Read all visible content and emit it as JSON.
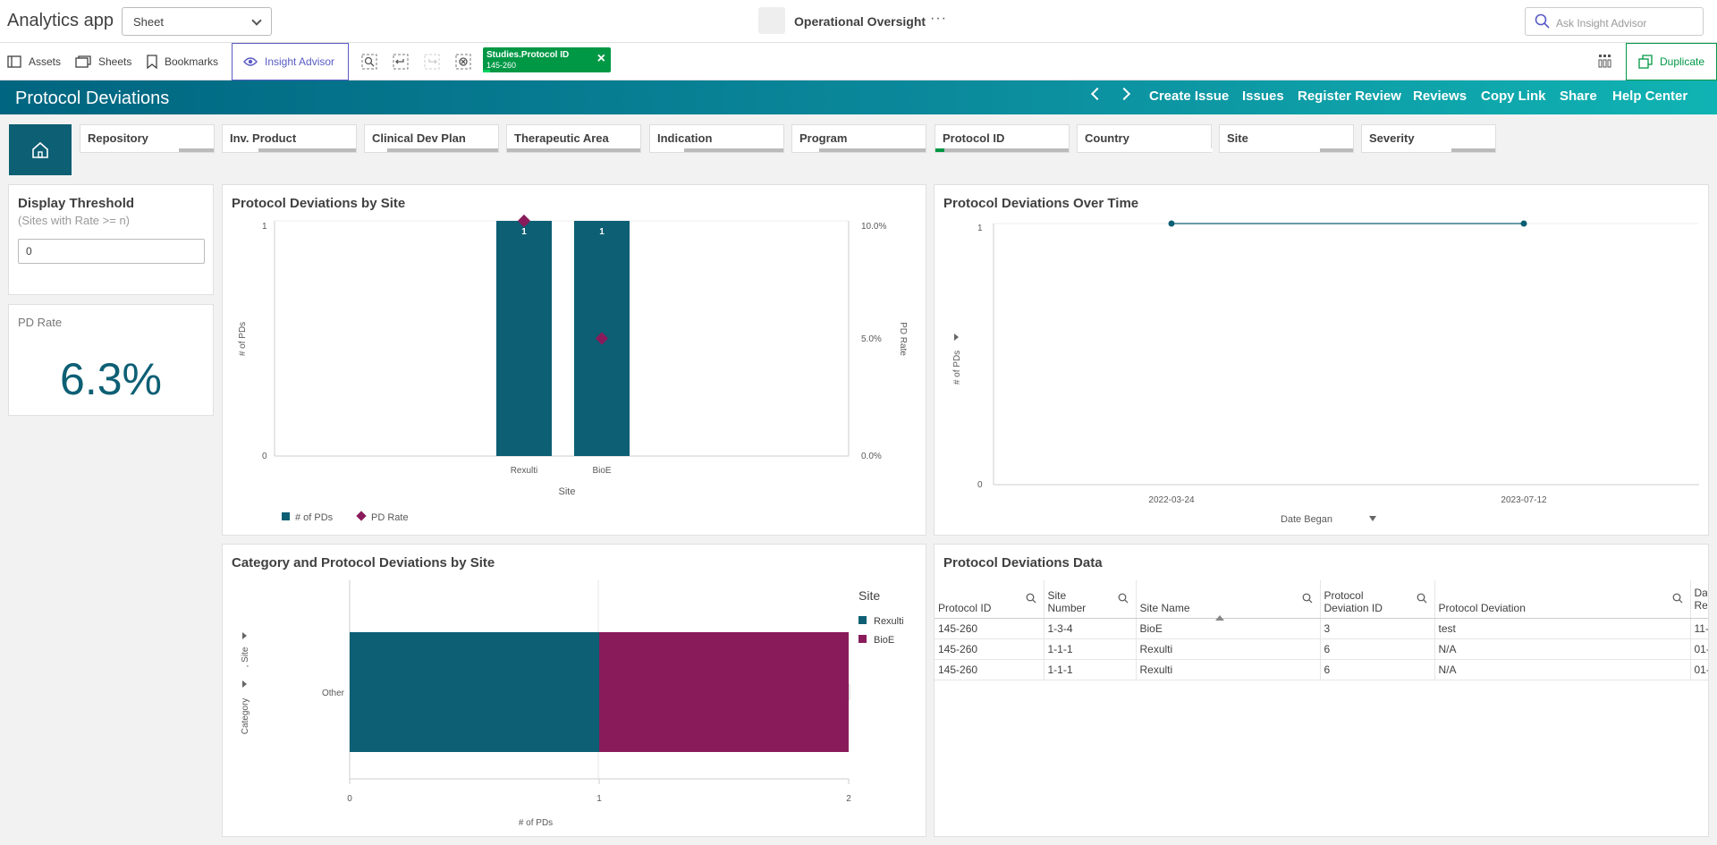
{
  "app": {
    "title": "Analytics app",
    "view_select": "Sheet",
    "sheet_name": "Operational Oversight",
    "ask_placeholder": "Ask Insight Advisor"
  },
  "toolbar": {
    "assets": "Assets",
    "sheets": "Sheets",
    "bookmarks": "Bookmarks",
    "insight": "Insight Advisor",
    "selection": {
      "field": "Studies.Protocol ID",
      "value": "145-260"
    },
    "duplicate": "Duplicate"
  },
  "banner": {
    "title": "Protocol Deviations",
    "links": [
      "Create Issue",
      "Issues",
      "Register Review",
      "Reviews",
      "Copy Link",
      "Share",
      "Help Center"
    ]
  },
  "filters": [
    "Repository",
    "Inv. Product",
    "Clinical Dev Plan",
    "Therapeutic Area",
    "Indication",
    "Program",
    "Protocol ID",
    "Country",
    "Site",
    "Severity"
  ],
  "threshold": {
    "title": "Display Threshold",
    "subtitle": "(Sites with Rate >= n)",
    "value": "0"
  },
  "kpi": {
    "label": "PD Rate",
    "value": "6.3%"
  },
  "charts": {
    "by_site": {
      "title": "Protocol Deviations by Site",
      "ylabel": "# of PDs",
      "y2label": "PD Rate",
      "xlabel": "Site",
      "y_ticks": [
        "1",
        "0"
      ],
      "y2_ticks": [
        "10.0%",
        "5.0%",
        "0.0%"
      ],
      "bar_labels": [
        "1",
        "1"
      ],
      "legend": [
        "# of PDs",
        "PD Rate"
      ]
    },
    "over_time": {
      "title": "Protocol Deviations Over Time",
      "ylabel": "# of PDs",
      "xlabel": "Date Began",
      "y_ticks": [
        "1",
        "0"
      ]
    },
    "category": {
      "title": "Category and Protocol Deviations by Site",
      "ylabel_category": "Category",
      "ylabel_site": ", Site",
      "xlabel": "# of PDs",
      "legend_title": "Site",
      "legend": [
        "Rexulti",
        "BioE"
      ],
      "x_ticks": [
        "0",
        "1",
        "2"
      ],
      "scroll_badge": "2"
    }
  },
  "chart_data": [
    {
      "type": "bar",
      "title": "Protocol Deviations by Site",
      "categories": [
        "Rexulti",
        "BioE"
      ],
      "series": [
        {
          "name": "# of PDs",
          "values": [
            1,
            1
          ],
          "color": "#0d5f74"
        },
        {
          "name": "PD Rate",
          "values": [
            0.1,
            0.05
          ],
          "color": "#8a1b5b",
          "axis": "secondary"
        }
      ],
      "xlabel": "Site",
      "ylabel": "# of PDs",
      "y2label": "PD Rate",
      "ylim": [
        0,
        1
      ],
      "y2lim": [
        0,
        0.1
      ]
    },
    {
      "type": "line",
      "title": "Protocol Deviations Over Time",
      "x": [
        "2022-03-24",
        "2023-07-12"
      ],
      "series": [
        {
          "name": "# of PDs",
          "values": [
            1,
            1
          ],
          "color": "#0d5f74"
        }
      ],
      "xlabel": "Date Began",
      "ylabel": "# of PDs",
      "ylim": [
        0,
        1
      ]
    },
    {
      "type": "bar",
      "title": "Category and Protocol Deviations by Site",
      "orientation": "horizontal-stacked",
      "categories": [
        "Other"
      ],
      "series": [
        {
          "name": "Rexulti",
          "values": [
            1
          ],
          "color": "#0d5f74"
        },
        {
          "name": "BioE",
          "values": [
            1
          ],
          "color": "#8a1b5b"
        }
      ],
      "xlabel": "# of PDs",
      "ylabel": "Category, Site",
      "xlim": [
        0,
        2
      ],
      "legend": "right"
    }
  ],
  "table": {
    "title": "Protocol Deviations Data",
    "columns": [
      "Protocol ID",
      "Site Number",
      "Site Name",
      "Protocol Deviation ID",
      "Protocol Deviation",
      "Dat Rec"
    ],
    "rows": [
      [
        "145-260",
        "1-3-4",
        "BioE",
        "3",
        "test",
        "11-"
      ],
      [
        "145-260",
        "1-1-1",
        "Rexulti",
        "6",
        "N/A",
        "01-"
      ],
      [
        "145-260",
        "1-1-1",
        "Rexulti",
        "6",
        "N/A",
        "01-"
      ]
    ]
  }
}
